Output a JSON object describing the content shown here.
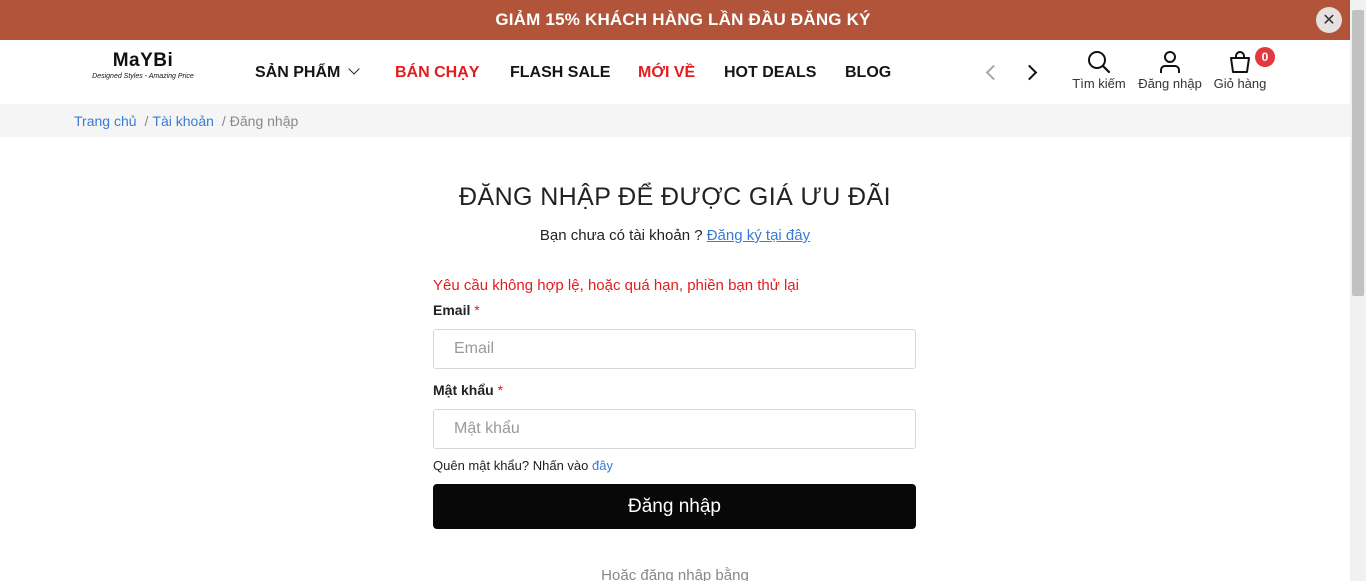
{
  "promo": {
    "text": "GIẢM 15% KHÁCH HÀNG LẦN ĐẦU ĐĂNG KÝ",
    "close": "✕"
  },
  "logo": {
    "name": "MaYBi",
    "tagline": "Designed Styles - Amazing Price"
  },
  "nav": {
    "items": [
      {
        "label": "SẢN PHẨM"
      },
      {
        "label": "BÁN CHẠY"
      },
      {
        "label": "FLASH SALE"
      },
      {
        "label": "MỚI VỀ"
      },
      {
        "label": "HOT DEALS"
      },
      {
        "label": "BLOG"
      }
    ]
  },
  "header_actions": {
    "search": "Tìm kiếm",
    "login": "Đăng nhập",
    "cart": "Giỏ hàng",
    "cart_count": "0"
  },
  "breadcrumb": {
    "home": "Trang chủ",
    "sep": "/",
    "account": "Tài khoản",
    "current": "Đăng nhập"
  },
  "main": {
    "title": "ĐĂNG NHẬP ĐỂ ĐƯỢC GIÁ ƯU ĐÃI",
    "no_account": "Bạn chưa có tài khoản ?",
    "register_link": "Đăng ký tại đây",
    "error": "Yêu cầu không hợp lệ, hoặc quá hạn, phiền bạn thử lại",
    "email_label": "Email",
    "email_placeholder": "Email",
    "password_label": "Mật khẩu",
    "password_placeholder": "Mật khẩu",
    "required_mark": "*",
    "forgot_text": "Quên mật khẩu? Nhấn vào",
    "forgot_link": "đây",
    "login_button": "Đăng nhập",
    "or_login_with": "Hoặc đăng nhập bằng"
  },
  "colors": {
    "promo_bg": "#b1543a",
    "accent_red": "#e21d1d",
    "link_blue": "#3a7bd5",
    "button_bg": "#080808"
  }
}
